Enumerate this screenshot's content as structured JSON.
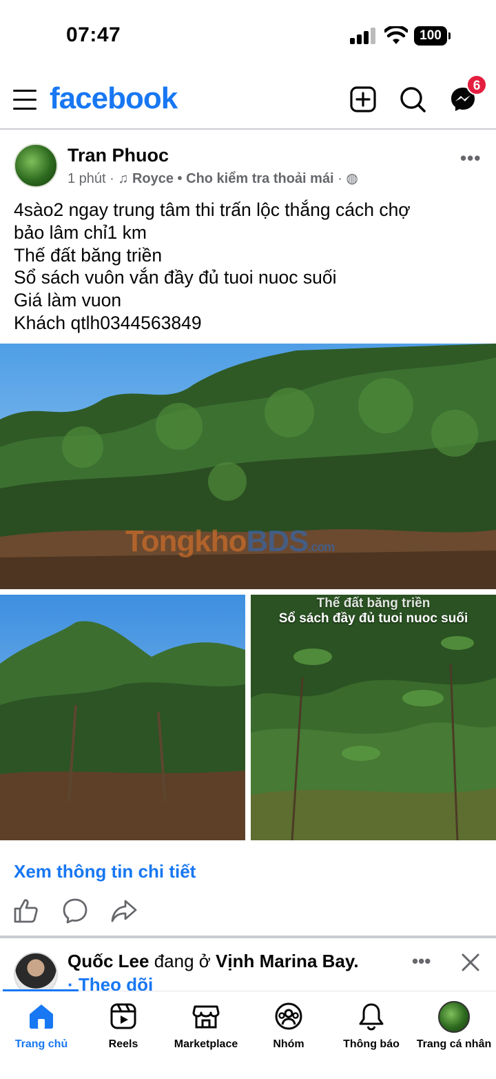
{
  "status_bar": {
    "time": "07:47",
    "battery": "100"
  },
  "header": {
    "logo": "facebook",
    "messenger_badge": "6"
  },
  "post": {
    "author": "Tran Phuoc",
    "time": "1 phút",
    "music": "Royce",
    "song": "Cho kiểm tra thoải mái",
    "text_lines": [
      "4sào2 ngay trung tâm thi trấn lộc thắng cách chợ",
      "bảo lâm chỉ1 km",
      "Thế đất băng triền",
      "Sổ sách  vuôn vắn đầy đủ tuoi nuoc suối",
      "Giá làm vuon",
      "Khách qtlh0344563849"
    ],
    "photo_caption_1": "Thế đất băng triền",
    "photo_caption_2": "Sổ sách đầy đủ tuoi nuoc suối",
    "watermark": {
      "a": "Tongkho",
      "b": "BDS",
      "c": ".com"
    },
    "see_more": "Xem thông tin chi tiết"
  },
  "next_post": {
    "author": "Quốc Lee",
    "mid": " đang ở ",
    "place": "Vịnh Marina Bay.",
    "follow": "· Theo dõi"
  },
  "nav": {
    "home": "Trang chủ",
    "reels": "Reels",
    "marketplace": "Marketplace",
    "groups": "Nhóm",
    "notifications": "Thông báo",
    "profile": "Trang cá nhân"
  },
  "colors": {
    "brand": "#1877f2",
    "badge": "#e41e3f"
  }
}
